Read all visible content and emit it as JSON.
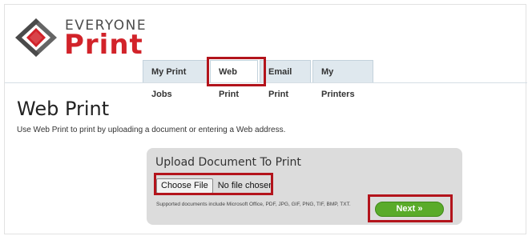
{
  "logo": {
    "top_text": "EVERYONE",
    "main_text": "Print",
    "mark_icon": "everyone-print-diamond-logo"
  },
  "tabs": [
    {
      "label": "My Print Jobs",
      "active": false
    },
    {
      "label": "Web Print",
      "active": true
    },
    {
      "label": "Email Print",
      "active": false
    },
    {
      "label": "My Printers",
      "active": false
    }
  ],
  "page": {
    "title": "Web Print",
    "description": "Use Web Print to print by uploading a document or entering a Web address."
  },
  "upload": {
    "title": "Upload Document To Print",
    "choose_file_label": "Choose File",
    "file_status": "No file chosen",
    "supported_text": "Supported documents include Microsoft Office, PDF, JPG, GIF, PNG, TIF, BMP, TXT.",
    "next_label": "Next »"
  },
  "colors": {
    "brand_red": "#d2232a",
    "tab_bg": "#dfe8ee",
    "panel_bg": "#dcdcdc",
    "next_green": "#5aab2a",
    "highlight_red": "#b3141c"
  }
}
